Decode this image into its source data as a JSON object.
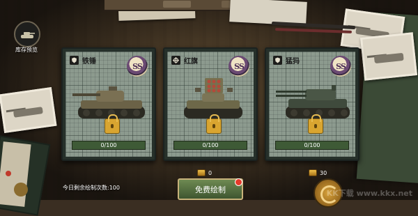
{
  "inventory": {
    "label": "库存预览",
    "icon": "tank-icon"
  },
  "cards": [
    {
      "name": "铁锤",
      "class_icon": "shield-icon",
      "badge": "SS",
      "progress_text": "0/100",
      "progress_fraction": 0,
      "locked": true
    },
    {
      "name": "红旗",
      "class_icon": "crosshair-icon",
      "badge": "SS",
      "progress_text": "0/100",
      "progress_fraction": 0,
      "locked": true
    },
    {
      "name": "猛犸",
      "class_icon": "shield-icon",
      "badge": "SS",
      "progress_text": "0/100",
      "progress_fraction": 0,
      "locked": true
    }
  ],
  "costs": {
    "left": "0",
    "right": "30"
  },
  "remaining_text": "今日剩余绘制次数:100",
  "draw_button": "免费绘制",
  "watermark": "KK下载 www.kkx.net",
  "colors": {
    "accent_green": "#3e5530",
    "badge_purple": "#6b4a73",
    "lock_gold": "#d9a530",
    "notify_red": "#e53a2a"
  }
}
